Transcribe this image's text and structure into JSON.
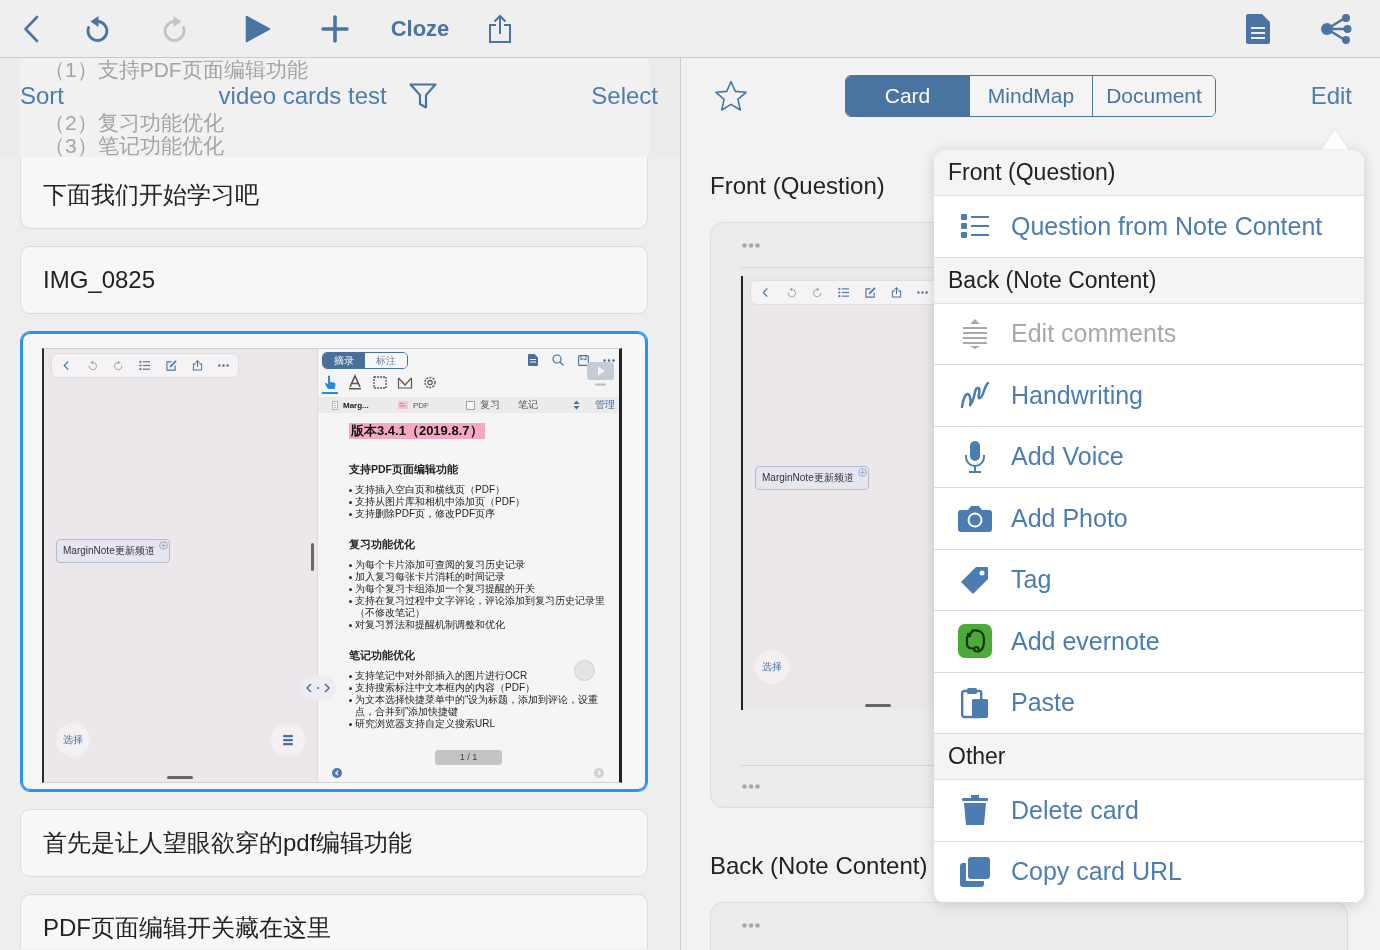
{
  "toolbar": {
    "buttons": [
      {
        "disabled": false
      },
      {
        "disabled": false
      },
      {
        "disabled": true
      },
      {
        "disabled": false
      },
      {
        "disabled": false
      },
      {
        "label": "Cloze",
        "disabled": false
      },
      {
        "disabled": false
      }
    ]
  },
  "note_list": {
    "sort": "Sort",
    "title": "video cards test",
    "select": "Select",
    "cards": [
      {
        "kind": "text",
        "list_lines": [
          "（1）支持PDF页面编辑功能",
          "（2）复习功能优化",
          "（3）笔记功能优化"
        ],
        "text": "下面我们开始学习吧",
        "selected": false
      },
      {
        "kind": "text",
        "text": "IMG_0825",
        "selected": false
      },
      {
        "kind": "image",
        "selected": true,
        "screenshot": {
          "mindmap_node": "MarginNote更新频道",
          "select_button": "选择",
          "doc_tabs": [
            {
              "label": "摘录",
              "selected": true
            },
            {
              "label": "标注",
              "selected": false
            }
          ],
          "tools": [
            {
              "selected": true
            },
            {
              "selected": false
            },
            {
              "selected": false
            },
            {
              "selected": false
            },
            {
              "selected": false
            }
          ],
          "source_tabs": [
            {
              "label": "Marg...",
              "selected": true
            },
            {
              "label": "PDF",
              "selected": false
            }
          ],
          "review": {
            "label": "复习",
            "checked": false
          },
          "notes": "笔记",
          "manage": "管理",
          "title": "版本3.4.1（2019.8.7）",
          "sections": [
            {
              "heading": "支持PDF页面编辑功能",
              "bullets": [
                "支持插入空白页和横线页（PDF）",
                "支持从图片库和相机中添加页（PDF）",
                "支持删除PDF页，修改PDF页序"
              ]
            },
            {
              "heading": "复习功能优化",
              "bullets": [
                "为每个卡片添加可查阅的复习历史记录",
                "加入复习每张卡片消耗的时间记录",
                "为每个复习卡组添加一个复习提醒的开关",
                "支持在复习过程中文字评论，评论添加到复习历史记录里（不修改笔记）",
                "对复习算法和提醒机制调整和优化"
              ]
            },
            {
              "heading": "笔记功能优化",
              "bullets": [
                "支持笔记中对外部插入的图片进行OCR",
                "支持搜索标注中文本框内的内容（PDF）",
                "为文本选择快捷菜单中的“设为标题，添加到评论，设重点，合并到”添加快捷键",
                "研究浏览器支持自定义搜索URL"
              ]
            }
          ],
          "page": "1 / 1"
        }
      },
      {
        "kind": "text",
        "text": "首先是让人望眼欲穿的pdf编辑功能",
        "selected": false
      },
      {
        "kind": "text",
        "text": "PDF页面编辑开关藏在这里",
        "selected": false
      }
    ]
  },
  "card_view": {
    "starred": false,
    "views": [
      {
        "label": "Card",
        "selected": true
      },
      {
        "label": "MindMap",
        "selected": false
      },
      {
        "label": "Document",
        "selected": false
      }
    ],
    "edit": "Edit",
    "front_title": "Front (Question)",
    "front_screenshot": {
      "mindmap_node": "MarginNote更新频道",
      "select_button": "选择"
    },
    "back_title": "Back (Note Content)"
  },
  "menu": {
    "sections": [
      {
        "title": "Front (Question)",
        "items": [
          {
            "label": "Question from Note Content",
            "disabled": false
          }
        ]
      },
      {
        "title": "Back (Note Content)",
        "items": [
          {
            "label": "Edit comments",
            "disabled": true
          },
          {
            "label": "Handwriting",
            "disabled": false
          },
          {
            "label": "Add Voice",
            "disabled": false
          },
          {
            "label": "Add Photo",
            "disabled": false
          },
          {
            "label": "Tag",
            "disabled": false
          },
          {
            "label": "Add evernote",
            "disabled": false
          },
          {
            "label": "Paste",
            "disabled": false
          }
        ]
      },
      {
        "title": "Other",
        "items": [
          {
            "label": "Delete card",
            "disabled": false
          },
          {
            "label": "Copy card URL",
            "disabled": false
          }
        ]
      }
    ]
  }
}
